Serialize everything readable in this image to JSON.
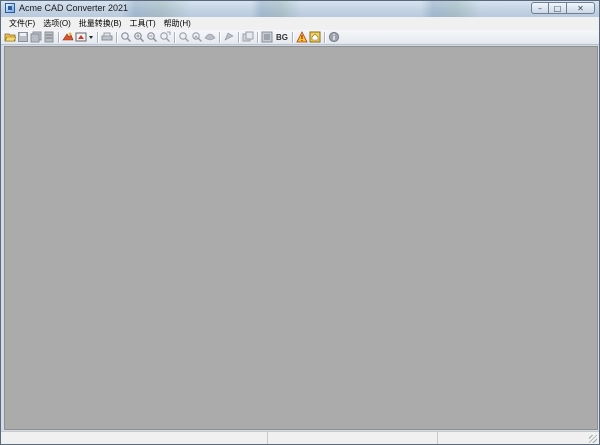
{
  "window": {
    "title": "Acme CAD Converter 2021",
    "buttons": {
      "minimize": "–",
      "maximize": "□",
      "close": "✕"
    }
  },
  "menubar": {
    "items": [
      {
        "label": "文件(F)"
      },
      {
        "label": "选项(O)"
      },
      {
        "label": "批量转换(B)"
      },
      {
        "label": "工具(T)"
      },
      {
        "label": "帮助(H)"
      }
    ]
  },
  "toolbar": {
    "bg_label": "BG",
    "icons": [
      "open-folder-icon",
      "save-icon",
      "save-all-icon",
      "batch-save-icon",
      "convert-icon",
      "export-icon",
      "dropdown-arrow-icon",
      "print-icon",
      "zoom-icon",
      "zoom-in-icon",
      "zoom-out-icon",
      "zoom-extents-icon",
      "zoom-window-icon",
      "zoom-realtime-icon",
      "pan-icon",
      "layers-icon",
      "copy-icon",
      "bg-icon",
      "warning-icon",
      "home-icon",
      "info-icon"
    ]
  },
  "workspace": {
    "background": "#ababab"
  },
  "statusbar": {
    "panels": [
      "",
      "",
      ""
    ]
  }
}
